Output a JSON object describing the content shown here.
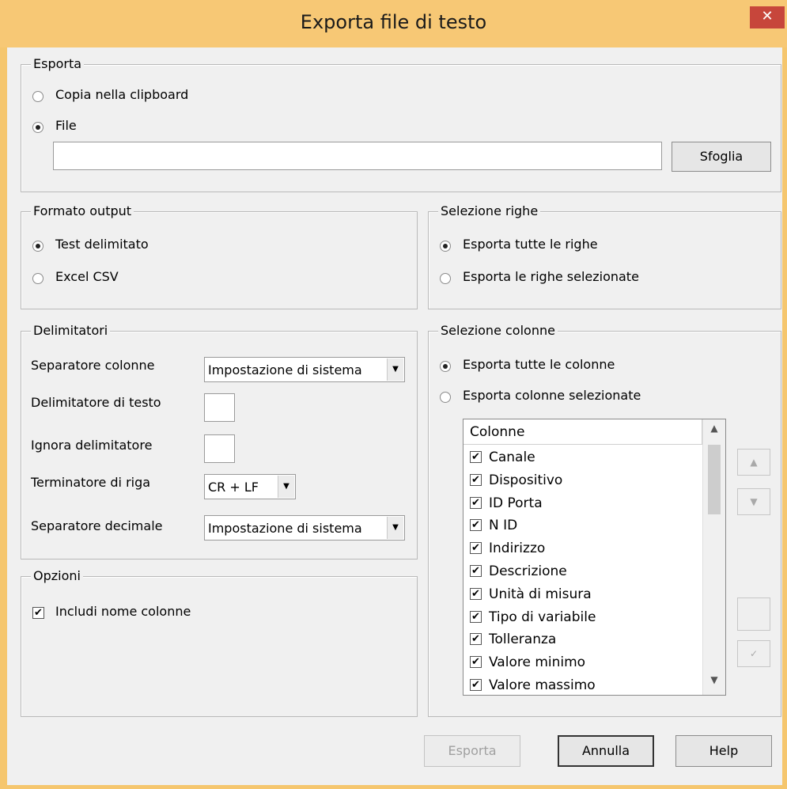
{
  "window": {
    "title": "Exporta file di testo",
    "close_label": "✕"
  },
  "esporta": {
    "label": "Esporta",
    "opt_clipboard": "Copia nella clipboard",
    "opt_file": "File",
    "selected": "File",
    "file_path": "",
    "browse_label": "Sfoglia"
  },
  "formato": {
    "label": "Formato output",
    "opt_delimited": "Test delimitato",
    "opt_csv": "Excel CSV",
    "selected": "Test delimitato"
  },
  "righe": {
    "label": "Selezione righe",
    "opt_all": "Esporta tutte le righe",
    "opt_selected": "Esporta le righe selezionate",
    "selected": "Esporta tutte le righe"
  },
  "delimitatori": {
    "label": "Delimitatori",
    "col_sep_label": "Separatore colonne",
    "col_sep_value": "Impostazione di sistema",
    "text_delim_label": "Delimitatore di testo",
    "text_delim_value": "",
    "ignore_label": "Ignora delimitatore",
    "ignore_value": "",
    "row_term_label": "Terminatore di riga",
    "row_term_value": "CR + LF",
    "dec_sep_label": "Separatore decimale",
    "dec_sep_value": "Impostazione di sistema"
  },
  "opzioni": {
    "label": "Opzioni",
    "include_names_label": "Includi nome colonne",
    "include_names_checked": true
  },
  "colonne": {
    "label": "Selezione colonne",
    "opt_all": "Esporta tutte le colonne",
    "opt_selected": "Esporta colonne selezionate",
    "selected": "Esporta tutte le colonne",
    "list_header": "Colonne",
    "items": [
      {
        "label": "Canale",
        "checked": true
      },
      {
        "label": "Dispositivo",
        "checked": true
      },
      {
        "label": "ID Porta",
        "checked": true
      },
      {
        "label": "N ID",
        "checked": true
      },
      {
        "label": "Indirizzo",
        "checked": true
      },
      {
        "label": "Descrizione",
        "checked": true
      },
      {
        "label": "Unità di misura",
        "checked": true
      },
      {
        "label": "Tipo di variabile",
        "checked": true
      },
      {
        "label": "Tolleranza",
        "checked": true
      },
      {
        "label": "Valore minimo",
        "checked": true
      },
      {
        "label": "Valore massimo",
        "checked": true
      }
    ]
  },
  "footer": {
    "export_label": "Esporta",
    "cancel_label": "Annulla",
    "help_label": "Help"
  }
}
